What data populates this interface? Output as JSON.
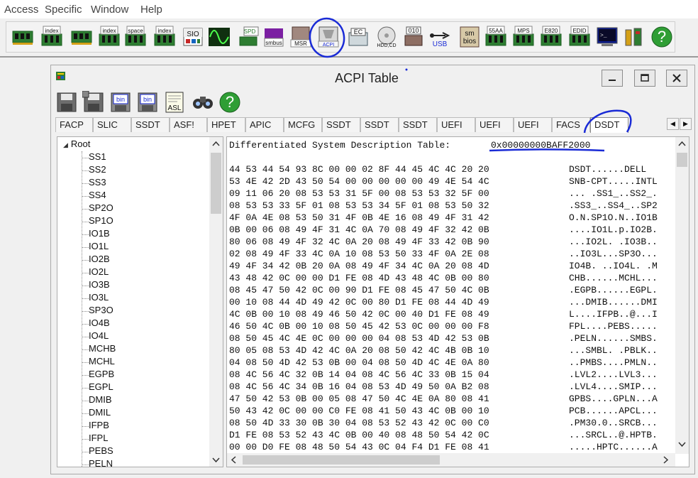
{
  "menu": [
    "Access",
    "Specific",
    "Window",
    "Help"
  ],
  "toolbar": {
    "buttons": [
      {
        "name": "memory-chip-icon",
        "label": ""
      },
      {
        "name": "memory-index-icon",
        "label": "index"
      },
      {
        "name": "memory-chip-2-icon",
        "label": ""
      },
      {
        "name": "io-index-icon",
        "label": "index"
      },
      {
        "name": "io-space-icon",
        "label": "space"
      },
      {
        "name": "io-index-2-icon",
        "label": "index"
      },
      {
        "name": "super-io-icon",
        "label": "SIO"
      },
      {
        "name": "waveform-icon",
        "label": ""
      },
      {
        "name": "spd-icon",
        "label": "SPD"
      },
      {
        "name": "smbus-icon",
        "label": "smbus"
      },
      {
        "name": "msr-icon",
        "label": "MSR"
      },
      {
        "name": "acpi-icon",
        "label": "ACPI"
      },
      {
        "name": "ec-icon",
        "label": "EC"
      },
      {
        "name": "hdd-cd-icon",
        "label": "HDD,CD"
      },
      {
        "name": "disk-010-icon",
        "label": "010"
      },
      {
        "name": "usb-icon",
        "label": "USB"
      },
      {
        "name": "smbios-icon",
        "label": "sm bios"
      },
      {
        "name": "pci-55aa-icon",
        "label": "55AA"
      },
      {
        "name": "mps-icon",
        "label": "MPS"
      },
      {
        "name": "e820-icon",
        "label": "E820"
      },
      {
        "name": "edid-icon",
        "label": "EDID"
      },
      {
        "name": "console-icon",
        "label": ""
      },
      {
        "name": "tools-icon",
        "label": ""
      },
      {
        "name": "help-icon",
        "label": "?"
      }
    ]
  },
  "window": {
    "title": "ACPI Table",
    "toolbar": [
      {
        "name": "save-icon",
        "label": ""
      },
      {
        "name": "save-all-icon",
        "label": ""
      },
      {
        "name": "save-bin-icon",
        "label": "bin"
      },
      {
        "name": "save-all-bin-icon",
        "label": "bin"
      },
      {
        "name": "asl-icon",
        "label": "ASL"
      },
      {
        "name": "find-icon",
        "label": ""
      },
      {
        "name": "help-icon",
        "label": "?"
      }
    ],
    "tabs": [
      "FACP",
      "SLIC",
      "SSDT",
      "ASF!",
      "HPET",
      "APIC",
      "MCFG",
      "SSDT",
      "SSDT",
      "SSDT",
      "UEFI",
      "UEFI",
      "UEFI",
      "FACS",
      "DSDT"
    ],
    "selected_tab": "DSDT"
  },
  "tree": {
    "root": "Root",
    "items": [
      "SS1",
      "SS2",
      "SS3",
      "SS4",
      "SP2O",
      "SP1O",
      "IO1B",
      "IO1L",
      "IO2B",
      "IO2L",
      "IO3B",
      "IO3L",
      "SP3O",
      "IO4B",
      "IO4L",
      "MCHB",
      "MCHL",
      "EGPB",
      "EGPL",
      "DMIB",
      "DMIL",
      "IFPB",
      "IFPL",
      "PEBS",
      "PELN"
    ]
  },
  "hex": {
    "header": "Differentiated System Description Table:",
    "address": "0x00000000BAFF2000",
    "lines": [
      {
        "hex": "44 53 44 54 93 8C 00 00 02 8F 44 45 4C 4C 20 20",
        "ascii": "DSDT......DELL"
      },
      {
        "hex": "53 4E 42 2D 43 50 54 00 00 00 00 00 49 4E 54 4C",
        "ascii": "SNB-CPT.....INTL"
      },
      {
        "hex": "09 11 06 20 08 53 53 31 5F 00 08 53 53 32 5F 00",
        "ascii": "... .SS1_..SS2_."
      },
      {
        "hex": "08 53 53 33 5F 01 08 53 53 34 5F 01 08 53 50 32",
        "ascii": ".SS3_..SS4_..SP2"
      },
      {
        "hex": "4F 0A 4E 08 53 50 31 4F 0B 4E 16 08 49 4F 31 42",
        "ascii": "O.N.SP1O.N..IO1B"
      },
      {
        "hex": "0B 00 06 08 49 4F 31 4C 0A 70 08 49 4F 32 42 0B",
        "ascii": "....IO1L.p.IO2B."
      },
      {
        "hex": "80 06 08 49 4F 32 4C 0A 20 08 49 4F 33 42 0B 90",
        "ascii": "...IO2L. .IO3B.."
      },
      {
        "hex": "02 08 49 4F 33 4C 0A 10 08 53 50 33 4F 0A 2E 08",
        "ascii": "..IO3L...SP3O..."
      },
      {
        "hex": "49 4F 34 42 0B 20 0A 08 49 4F 34 4C 0A 20 08 4D",
        "ascii": "IO4B. ..IO4L. .M"
      },
      {
        "hex": "43 48 42 0C 00 00 D1 FE 08 4D 43 48 4C 0B 00 80",
        "ascii": "CHB......MCHL..."
      },
      {
        "hex": "08 45 47 50 42 0C 00 90 D1 FE 08 45 47 50 4C 0B",
        "ascii": ".EGPB......EGPL."
      },
      {
        "hex": "00 10 08 44 4D 49 42 0C 00 80 D1 FE 08 44 4D 49",
        "ascii": "...DMIB......DMI"
      },
      {
        "hex": "4C 0B 00 10 08 49 46 50 42 0C 00 40 D1 FE 08 49",
        "ascii": "L....IFPB..@...I"
      },
      {
        "hex": "46 50 4C 0B 00 10 08 50 45 42 53 0C 00 00 00 F8",
        "ascii": "FPL....PEBS....."
      },
      {
        "hex": "08 50 45 4C 4E 0C 00 00 00 04 08 53 4D 42 53 0B",
        "ascii": ".PELN......SMBS."
      },
      {
        "hex": "80 05 08 53 4D 42 4C 0A 20 08 50 42 4C 4B 0B 10",
        "ascii": "...SMBL. .PBLK.."
      },
      {
        "hex": "04 08 50 4D 42 53 0B 00 04 08 50 4D 4C 4E 0A 80",
        "ascii": "..PMBS....PMLN.."
      },
      {
        "hex": "08 4C 56 4C 32 0B 14 04 08 4C 56 4C 33 0B 15 04",
        "ascii": ".LVL2....LVL3..."
      },
      {
        "hex": "08 4C 56 4C 34 0B 16 04 08 53 4D 49 50 0A B2 08",
        "ascii": ".LVL4....SMIP..."
      },
      {
        "hex": "47 50 42 53 0B 00 05 08 47 50 4C 4E 0A 80 08 41",
        "ascii": "GPBS....GPLN...A"
      },
      {
        "hex": "50 43 42 0C 00 00 C0 FE 08 41 50 43 4C 0B 00 10",
        "ascii": "PCB......APCL..."
      },
      {
        "hex": "08 50 4D 33 30 0B 30 04 08 53 52 43 42 0C 00 C0",
        "ascii": ".PM30.0..SRCB..."
      },
      {
        "hex": "D1 FE 08 53 52 43 4C 0B 00 40 08 48 50 54 42 0C",
        "ascii": "...SRCL..@.HPTB."
      },
      {
        "hex": "00 00 D0 FE 08 48 50 54 43 0C 04 F4 D1 FE 08 41",
        "ascii": ".....HPTC......A"
      }
    ]
  }
}
